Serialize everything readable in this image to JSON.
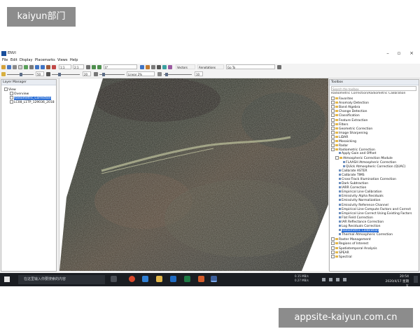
{
  "watermarks": {
    "top": "kaiyun部门",
    "bottom": "appsite-kaiyun.com.cn"
  },
  "app": {
    "title": "ENVI",
    "menu": [
      "File",
      "Edit",
      "Display",
      "Placemarks",
      "Views",
      "Help"
    ],
    "toolbar": {
      "zoom_combo": "1:1",
      "scale_combo": "2:1",
      "rotation_combo": "0°",
      "value_a": "50",
      "value_b": "20",
      "value_c": "10",
      "stretch_combo": "Linear 2%",
      "vectors_label": "Vectors",
      "annotations_label": "Annotations",
      "go_to_value": "Go To"
    }
  },
  "layer_manager": {
    "title": "Layer Manager",
    "items": [
      {
        "label": "View"
      },
      {
        "label": "Overview"
      },
      {
        "label": "Radiometric_Correction"
      },
      {
        "label": "LC08_L1TP_129036_2018"
      }
    ]
  },
  "toolbox": {
    "title": "Toolbox",
    "search_placeholder": "Search the toolbox",
    "breadcrumb": "Radiometric Correction/Radiometric Calibration",
    "items": [
      {
        "label": "Favorites",
        "type": "folder",
        "indent": 0
      },
      {
        "label": "Anomaly Detection",
        "type": "folder",
        "indent": 0
      },
      {
        "label": "Band Algebra",
        "type": "folder",
        "indent": 0
      },
      {
        "label": "Change Detection",
        "type": "folder",
        "indent": 0
      },
      {
        "label": "Classification",
        "type": "folder",
        "indent": 0
      },
      {
        "label": "Feature Extraction",
        "type": "folder",
        "indent": 0
      },
      {
        "label": "Filters",
        "type": "folder",
        "indent": 0
      },
      {
        "label": "Geometric Correction",
        "type": "folder",
        "indent": 0
      },
      {
        "label": "Image Sharpening",
        "type": "folder",
        "indent": 0
      },
      {
        "label": "LiDAR",
        "type": "folder",
        "indent": 0
      },
      {
        "label": "Mosaicking",
        "type": "folder",
        "indent": 0
      },
      {
        "label": "Radar",
        "type": "folder",
        "indent": 0
      },
      {
        "label": "Radiometric Correction",
        "type": "folder",
        "indent": 0
      },
      {
        "label": "Apply Gain and Offset",
        "type": "tool",
        "indent": 1
      },
      {
        "label": "Atmospheric Correction Module",
        "type": "folder",
        "indent": 1
      },
      {
        "label": "FLAASH Atmospheric Correction",
        "type": "tool",
        "indent": 2
      },
      {
        "label": "QUick Atmospheric Correction (QUAC)",
        "type": "tool",
        "indent": 2
      },
      {
        "label": "Calibrate ASTER",
        "type": "tool",
        "indent": 1
      },
      {
        "label": "Calibrate TIMS",
        "type": "tool",
        "indent": 1
      },
      {
        "label": "Cross-Track Illumination Correction",
        "type": "tool",
        "indent": 1
      },
      {
        "label": "Dark Subtraction",
        "type": "tool",
        "indent": 1
      },
      {
        "label": "IARR Correction",
        "type": "tool",
        "indent": 1
      },
      {
        "label": "Empirical Line Calibration",
        "type": "tool",
        "indent": 1
      },
      {
        "label": "Emissivity Alpha Residuals",
        "type": "tool",
        "indent": 1
      },
      {
        "label": "Emissivity Normalization",
        "type": "tool",
        "indent": 1
      },
      {
        "label": "Emissivity Reference Channel",
        "type": "tool",
        "indent": 1
      },
      {
        "label": "Empirical Line Compute Factors and Correct",
        "type": "tool",
        "indent": 1
      },
      {
        "label": "Empirical Line Correct Using Existing Factors",
        "type": "tool",
        "indent": 1
      },
      {
        "label": "Flat Field Correction",
        "type": "tool",
        "indent": 1
      },
      {
        "label": "IAR Reflectance Correction",
        "type": "tool",
        "indent": 1
      },
      {
        "label": "Log Residuals Correction",
        "type": "tool",
        "indent": 1
      },
      {
        "label": "Radiometric Calibration",
        "type": "tool",
        "indent": 1,
        "selected": true
      },
      {
        "label": "Thermal Atmospheric Correction",
        "type": "tool",
        "indent": 1
      },
      {
        "label": "Raster Management",
        "type": "folder",
        "indent": 0
      },
      {
        "label": "Regions of Interest",
        "type": "folder",
        "indent": 0
      },
      {
        "label": "Spatiotemporal Analysis",
        "type": "folder",
        "indent": 0
      },
      {
        "label": "SPEAR",
        "type": "folder",
        "indent": 0
      },
      {
        "label": "Spectral",
        "type": "folder",
        "indent": 0
      }
    ]
  },
  "taskbar": {
    "search_placeholder": "在这里输入你要搜索的内容",
    "net_up": "0.15 MB/s",
    "net_down": "0.27 MB/s",
    "time": "20:54",
    "date": "2020/4/17 星期五"
  },
  "colors": {
    "selection": "#2b6fd6",
    "taskbar": "#1a1d22",
    "folder": "#e2b64a"
  }
}
